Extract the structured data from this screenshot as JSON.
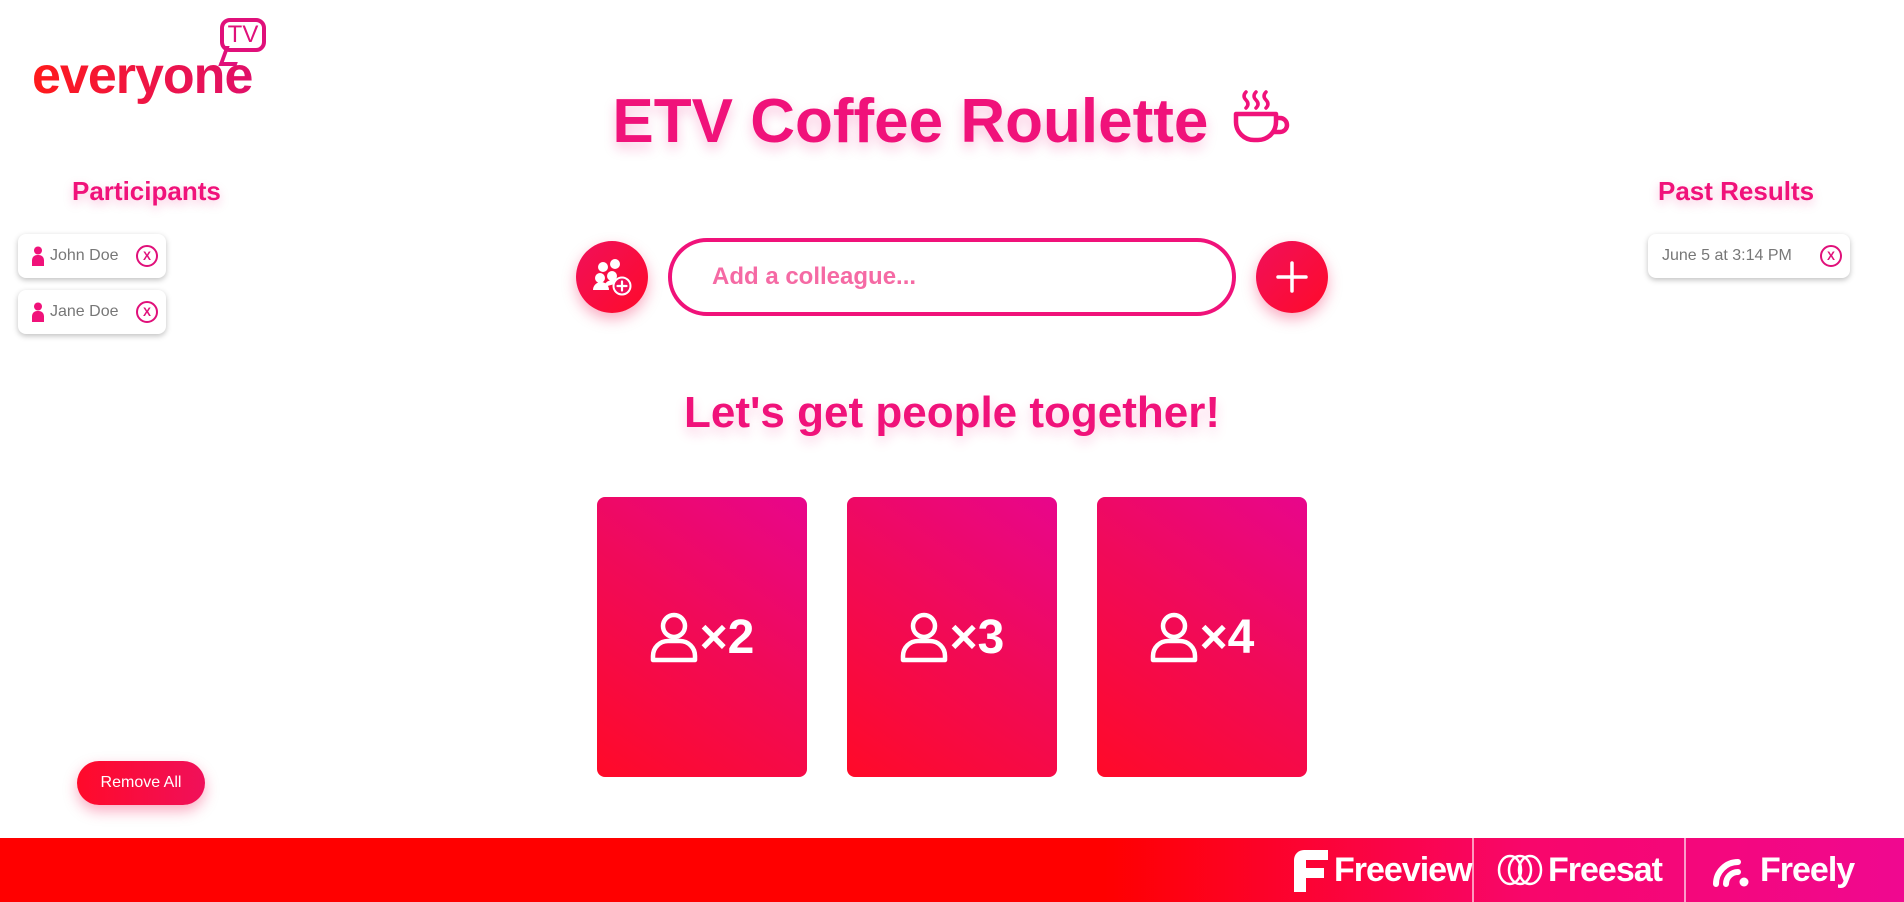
{
  "logo": {
    "word": "everyone",
    "badge": "TV"
  },
  "title": "ETV Coffee Roulette",
  "participants": {
    "heading": "Participants",
    "items": [
      {
        "name": "John Doe",
        "remove": "X"
      },
      {
        "name": "Jane Doe",
        "remove": "X"
      }
    ]
  },
  "past_results": {
    "heading": "Past Results",
    "items": [
      {
        "label": "June 5 at 3:14 PM",
        "remove": "X"
      }
    ]
  },
  "add_colleague": {
    "placeholder": "Add a colleague..."
  },
  "subtitle": "Let's get people together!",
  "group_cards": [
    {
      "label": "×2"
    },
    {
      "label": "×3"
    },
    {
      "label": "×4"
    }
  ],
  "remove_all": "Remove All",
  "footer": {
    "brands": [
      "Freeview",
      "Freesat",
      "Freely"
    ]
  },
  "colors": {
    "accent": "#f0127a",
    "red": "#ff0a2a"
  }
}
